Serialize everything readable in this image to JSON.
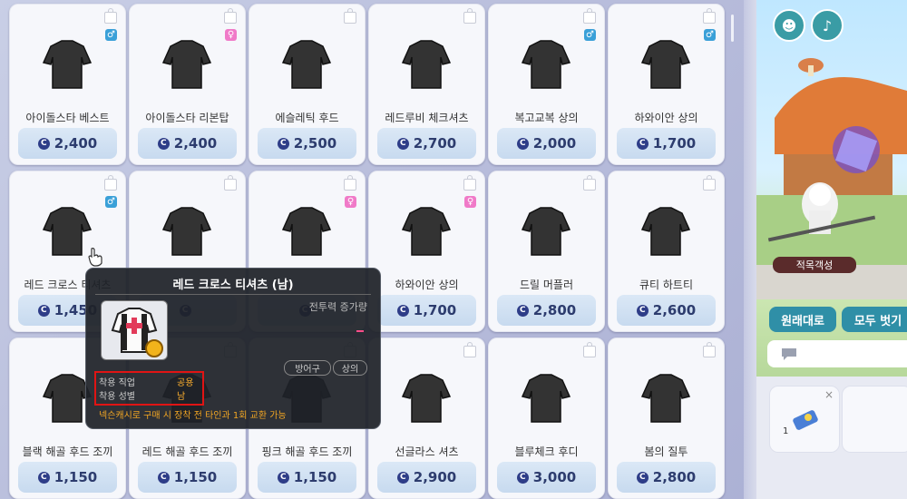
{
  "items": [
    {
      "name": "아이돌스타 베스트",
      "price": "2,400",
      "gender": "♂",
      "gtype": "m",
      "icon": "vest-icon"
    },
    {
      "name": "아이돌스타 리본탑",
      "price": "2,400",
      "gender": "♀",
      "gtype": "f",
      "icon": "ribbon-top-icon"
    },
    {
      "name": "에슬레틱 후드",
      "price": "2,500",
      "gender": "",
      "gtype": "",
      "icon": "hoodie-icon"
    },
    {
      "name": "레드루비 체크셔츠",
      "price": "2,700",
      "gender": "",
      "gtype": "",
      "icon": "check-shirt-icon"
    },
    {
      "name": "복고교복 상의",
      "price": "2,000",
      "gender": "♂",
      "gtype": "m",
      "icon": "uniform-icon"
    },
    {
      "name": "하와이안 상의",
      "price": "1,700",
      "gender": "♂",
      "gtype": "m",
      "icon": "lei-icon"
    },
    {
      "name": "레드 크로스 티셔츠",
      "price": "1,450",
      "gender": "♂",
      "gtype": "m",
      "icon": "cross-tshirt-icon"
    },
    {
      "name": "",
      "price": "",
      "gender": "",
      "gtype": "",
      "icon": "jacket-icon"
    },
    {
      "name": "",
      "price": "",
      "gender": "♀",
      "gtype": "f",
      "icon": "track-top-icon"
    },
    {
      "name": "하와이안 상의",
      "price": "1,700",
      "gender": "♀",
      "gtype": "f",
      "icon": "lei-icon"
    },
    {
      "name": "드릴 머플러",
      "price": "2,800",
      "gender": "",
      "gtype": "",
      "icon": "muffler-icon"
    },
    {
      "name": "큐티 하트티",
      "price": "2,600",
      "gender": "",
      "gtype": "",
      "icon": "heart-tee-icon"
    },
    {
      "name": "블랙 해골 후드 조끼",
      "price": "1,150",
      "gender": "",
      "gtype": "",
      "icon": "skull-vest-icon"
    },
    {
      "name": "레드 해골 후드 조끼",
      "price": "1,150",
      "gender": "",
      "gtype": "",
      "icon": "skull-vest-icon"
    },
    {
      "name": "핑크 해골 후드 조끼",
      "price": "1,150",
      "gender": "",
      "gtype": "",
      "icon": "skull-vest-icon"
    },
    {
      "name": "선글라스 셔츠",
      "price": "2,900",
      "gender": "",
      "gtype": "",
      "icon": "sunglass-shirt-icon"
    },
    {
      "name": "블루체크 후디",
      "price": "3,000",
      "gender": "",
      "gtype": "",
      "icon": "blue-hoodie-icon"
    },
    {
      "name": "봄의 질투",
      "price": "2,800",
      "gender": "",
      "gtype": "",
      "icon": "yellow-hoodie-icon"
    }
  ],
  "coin_glyph": "C",
  "tooltip": {
    "title": "레드 크로스 티셔츠 (남)",
    "stat_label": "전투력 증가량",
    "tag1": "방어구",
    "tag2": "상의",
    "row1_label": "착용 직업",
    "row1_value": "공용",
    "row2_label": "착용 성별",
    "row2_value": "남",
    "note": "넥슨캐시로 구매 시 장착 전 타인과 1회 교환 가능"
  },
  "right_panel": {
    "title_badge": "적목객성",
    "btn_reset": "원래대로",
    "btn_undress": "모두 벗기",
    "slot_count": "1"
  },
  "colors": {
    "accent": "#2f8fa7",
    "coin": "#2e3d88",
    "male": "#3aa0d8",
    "female": "#f07ac8",
    "highlight": "#e01414"
  }
}
